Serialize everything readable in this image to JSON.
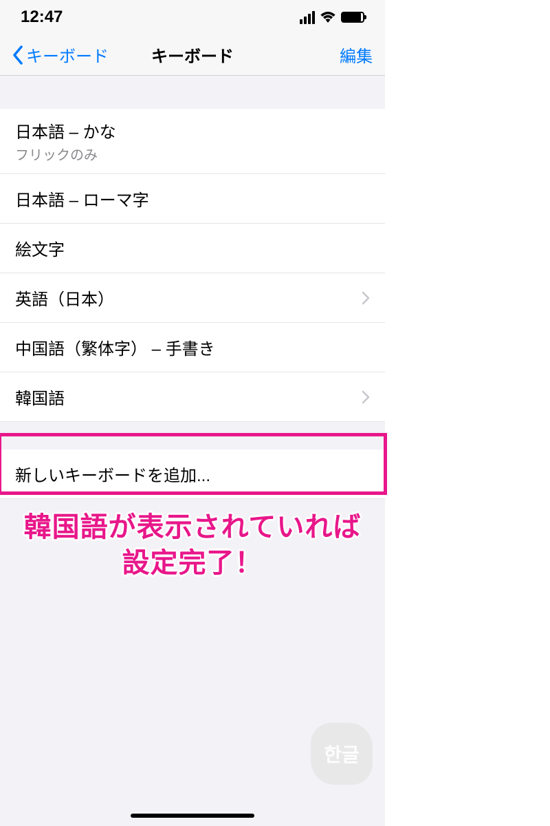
{
  "status": {
    "time": "12:47"
  },
  "nav": {
    "back": "キーボード",
    "title": "キーボード",
    "edit": "編集"
  },
  "keyboards": [
    {
      "title": "日本語 – かな",
      "subtitle": "フリックのみ",
      "chevron": false
    },
    {
      "title": "日本語 – ローマ字",
      "subtitle": "",
      "chevron": false
    },
    {
      "title": "絵文字",
      "subtitle": "",
      "chevron": false
    },
    {
      "title": "英語（日本）",
      "subtitle": "",
      "chevron": true
    },
    {
      "title": "中国語（繁体字） – 手書き",
      "subtitle": "",
      "chevron": false
    },
    {
      "title": "韓国語",
      "subtitle": "",
      "chevron": true
    }
  ],
  "add_row": {
    "title": "新しいキーボードを追加..."
  },
  "annotation": {
    "line1": "韓国語が表示されていれば",
    "line2": "設定完了！"
  },
  "watermark": "한글",
  "colors": {
    "accent": "#007aff",
    "highlight": "#e8178a"
  }
}
